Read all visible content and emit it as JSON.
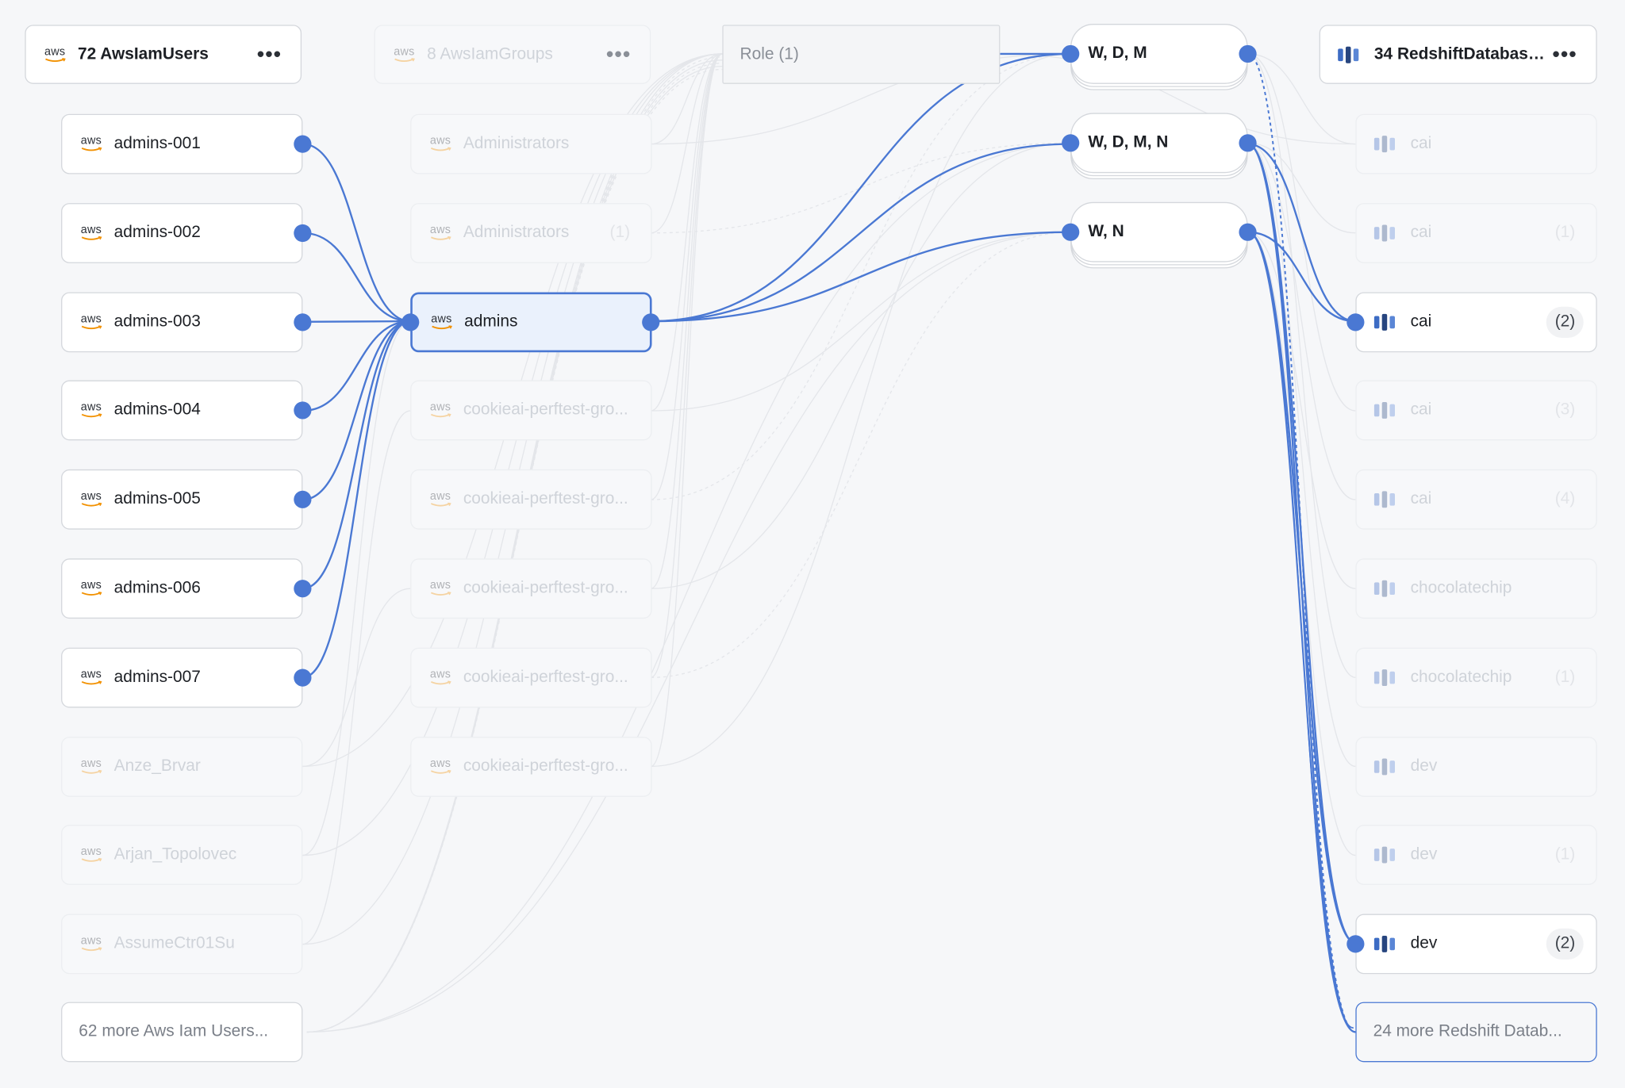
{
  "columns": {
    "users": {
      "header": "72 AwsIamUsers",
      "items": [
        "admins-001",
        "admins-002",
        "admins-003",
        "admins-004",
        "admins-005",
        "admins-006",
        "admins-007",
        "Anze_Brvar",
        "Arjan_Topolovec",
        "AssumeCtr01Su"
      ],
      "more": "62 more Aws Iam Users..."
    },
    "groups": {
      "header": "8 AwsIamGroups",
      "items": [
        {
          "label": "Administrators",
          "badge": ""
        },
        {
          "label": "Administrators",
          "badge": "(1)"
        },
        {
          "label": "admins",
          "badge": ""
        },
        {
          "label": "cookieai-perftest-gro...",
          "badge": ""
        },
        {
          "label": "cookieai-perftest-gro...",
          "badge": ""
        },
        {
          "label": "cookieai-perftest-gro...",
          "badge": ""
        },
        {
          "label": "cookieai-perftest-gro...",
          "badge": ""
        },
        {
          "label": "cookieai-perftest-gro...",
          "badge": ""
        }
      ]
    },
    "role": {
      "header": "Role (1)"
    },
    "permissions": {
      "items": [
        "W, D, M",
        "W, D, M, N",
        "W, N"
      ]
    },
    "databases": {
      "header": "34 RedshiftDatabaseI...",
      "items": [
        {
          "label": "cai",
          "badge": ""
        },
        {
          "label": "cai",
          "badge": "(1)"
        },
        {
          "label": "cai",
          "badge": "(2)"
        },
        {
          "label": "cai",
          "badge": "(3)"
        },
        {
          "label": "cai",
          "badge": "(4)"
        },
        {
          "label": "chocolatechip",
          "badge": ""
        },
        {
          "label": "chocolatechip",
          "badge": "(1)"
        },
        {
          "label": "dev",
          "badge": ""
        },
        {
          "label": "dev",
          "badge": "(1)"
        },
        {
          "label": "dev",
          "badge": "(2)"
        }
      ],
      "more": "24 more Redshift Datab..."
    }
  },
  "icons": {
    "aws": "aws-logo-icon",
    "redshift": "redshift-database-icon",
    "menu": "more-options-icon"
  },
  "aws_logo_text": "aws",
  "menu_glyph": "•••",
  "colors": {
    "accent": "#4a78d3",
    "faded_edge": "#e4e6ea",
    "aws_orange": "#f29100"
  }
}
